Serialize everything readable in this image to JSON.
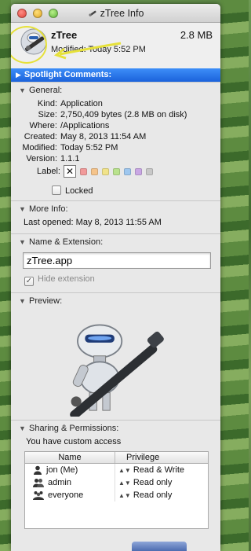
{
  "window": {
    "title": "zTree Info"
  },
  "header": {
    "app_name": "zTree",
    "size": "2.8 MB",
    "modified": "Modified: Today 5:52 PM"
  },
  "spotlight": {
    "label": "Spotlight Comments:"
  },
  "general": {
    "title": "General:",
    "rows": [
      {
        "k": "Kind:",
        "v": "Application"
      },
      {
        "k": "Size:",
        "v": "2,750,409 bytes (2.8 MB on disk)"
      },
      {
        "k": "Where:",
        "v": "/Applications"
      },
      {
        "k": "Created:",
        "v": "May 8, 2013 11:54 AM"
      },
      {
        "k": "Modified:",
        "v": "Today 5:52 PM"
      },
      {
        "k": "Version:",
        "v": "1.1.1"
      }
    ],
    "label_key": "Label:",
    "label_colors": [
      "#f19a9a",
      "#f5c48b",
      "#f1e38a",
      "#b9e28d",
      "#9ec7ef",
      "#c9a7e4",
      "#c8c8c8"
    ],
    "locked_label": "Locked"
  },
  "more_info": {
    "title": "More Info:",
    "last_opened": "Last opened: May 8, 2013 11:55 AM"
  },
  "name_ext": {
    "title": "Name & Extension:",
    "filename": "zTree.app",
    "hide_ext_label": "Hide extension"
  },
  "preview": {
    "title": "Preview:"
  },
  "sharing": {
    "title": "Sharing & Permissions:",
    "access_note": "You have custom access",
    "col_name": "Name",
    "col_priv": "Privilege",
    "rows": [
      {
        "name": "jon (Me)",
        "priv": "Read & Write",
        "icon": "user-icon"
      },
      {
        "name": "admin",
        "priv": "Read only",
        "icon": "group-icon"
      },
      {
        "name": "everyone",
        "priv": "Read only",
        "icon": "everyone-icon"
      }
    ]
  }
}
